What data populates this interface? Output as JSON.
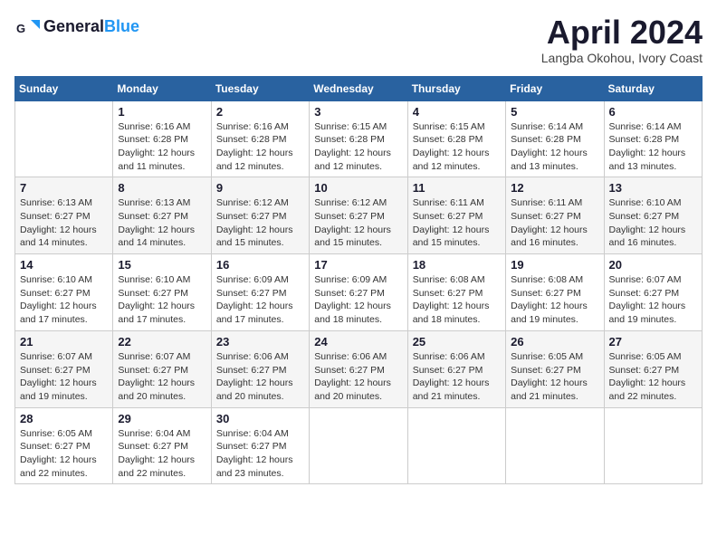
{
  "header": {
    "logo_line1": "General",
    "logo_line2": "Blue",
    "month_title": "April 2024",
    "subtitle": "Langba Okohou, Ivory Coast"
  },
  "weekdays": [
    "Sunday",
    "Monday",
    "Tuesday",
    "Wednesday",
    "Thursday",
    "Friday",
    "Saturday"
  ],
  "weeks": [
    [
      {
        "day": "",
        "info": ""
      },
      {
        "day": "1",
        "info": "Sunrise: 6:16 AM\nSunset: 6:28 PM\nDaylight: 12 hours\nand 11 minutes."
      },
      {
        "day": "2",
        "info": "Sunrise: 6:16 AM\nSunset: 6:28 PM\nDaylight: 12 hours\nand 12 minutes."
      },
      {
        "day": "3",
        "info": "Sunrise: 6:15 AM\nSunset: 6:28 PM\nDaylight: 12 hours\nand 12 minutes."
      },
      {
        "day": "4",
        "info": "Sunrise: 6:15 AM\nSunset: 6:28 PM\nDaylight: 12 hours\nand 12 minutes."
      },
      {
        "day": "5",
        "info": "Sunrise: 6:14 AM\nSunset: 6:28 PM\nDaylight: 12 hours\nand 13 minutes."
      },
      {
        "day": "6",
        "info": "Sunrise: 6:14 AM\nSunset: 6:28 PM\nDaylight: 12 hours\nand 13 minutes."
      }
    ],
    [
      {
        "day": "7",
        "info": "Sunrise: 6:13 AM\nSunset: 6:27 PM\nDaylight: 12 hours\nand 14 minutes."
      },
      {
        "day": "8",
        "info": "Sunrise: 6:13 AM\nSunset: 6:27 PM\nDaylight: 12 hours\nand 14 minutes."
      },
      {
        "day": "9",
        "info": "Sunrise: 6:12 AM\nSunset: 6:27 PM\nDaylight: 12 hours\nand 15 minutes."
      },
      {
        "day": "10",
        "info": "Sunrise: 6:12 AM\nSunset: 6:27 PM\nDaylight: 12 hours\nand 15 minutes."
      },
      {
        "day": "11",
        "info": "Sunrise: 6:11 AM\nSunset: 6:27 PM\nDaylight: 12 hours\nand 15 minutes."
      },
      {
        "day": "12",
        "info": "Sunrise: 6:11 AM\nSunset: 6:27 PM\nDaylight: 12 hours\nand 16 minutes."
      },
      {
        "day": "13",
        "info": "Sunrise: 6:10 AM\nSunset: 6:27 PM\nDaylight: 12 hours\nand 16 minutes."
      }
    ],
    [
      {
        "day": "14",
        "info": "Sunrise: 6:10 AM\nSunset: 6:27 PM\nDaylight: 12 hours\nand 17 minutes."
      },
      {
        "day": "15",
        "info": "Sunrise: 6:10 AM\nSunset: 6:27 PM\nDaylight: 12 hours\nand 17 minutes."
      },
      {
        "day": "16",
        "info": "Sunrise: 6:09 AM\nSunset: 6:27 PM\nDaylight: 12 hours\nand 17 minutes."
      },
      {
        "day": "17",
        "info": "Sunrise: 6:09 AM\nSunset: 6:27 PM\nDaylight: 12 hours\nand 18 minutes."
      },
      {
        "day": "18",
        "info": "Sunrise: 6:08 AM\nSunset: 6:27 PM\nDaylight: 12 hours\nand 18 minutes."
      },
      {
        "day": "19",
        "info": "Sunrise: 6:08 AM\nSunset: 6:27 PM\nDaylight: 12 hours\nand 19 minutes."
      },
      {
        "day": "20",
        "info": "Sunrise: 6:07 AM\nSunset: 6:27 PM\nDaylight: 12 hours\nand 19 minutes."
      }
    ],
    [
      {
        "day": "21",
        "info": "Sunrise: 6:07 AM\nSunset: 6:27 PM\nDaylight: 12 hours\nand 19 minutes."
      },
      {
        "day": "22",
        "info": "Sunrise: 6:07 AM\nSunset: 6:27 PM\nDaylight: 12 hours\nand 20 minutes."
      },
      {
        "day": "23",
        "info": "Sunrise: 6:06 AM\nSunset: 6:27 PM\nDaylight: 12 hours\nand 20 minutes."
      },
      {
        "day": "24",
        "info": "Sunrise: 6:06 AM\nSunset: 6:27 PM\nDaylight: 12 hours\nand 20 minutes."
      },
      {
        "day": "25",
        "info": "Sunrise: 6:06 AM\nSunset: 6:27 PM\nDaylight: 12 hours\nand 21 minutes."
      },
      {
        "day": "26",
        "info": "Sunrise: 6:05 AM\nSunset: 6:27 PM\nDaylight: 12 hours\nand 21 minutes."
      },
      {
        "day": "27",
        "info": "Sunrise: 6:05 AM\nSunset: 6:27 PM\nDaylight: 12 hours\nand 22 minutes."
      }
    ],
    [
      {
        "day": "28",
        "info": "Sunrise: 6:05 AM\nSunset: 6:27 PM\nDaylight: 12 hours\nand 22 minutes."
      },
      {
        "day": "29",
        "info": "Sunrise: 6:04 AM\nSunset: 6:27 PM\nDaylight: 12 hours\nand 22 minutes."
      },
      {
        "day": "30",
        "info": "Sunrise: 6:04 AM\nSunset: 6:27 PM\nDaylight: 12 hours\nand 23 minutes."
      },
      {
        "day": "",
        "info": ""
      },
      {
        "day": "",
        "info": ""
      },
      {
        "day": "",
        "info": ""
      },
      {
        "day": "",
        "info": ""
      }
    ]
  ]
}
